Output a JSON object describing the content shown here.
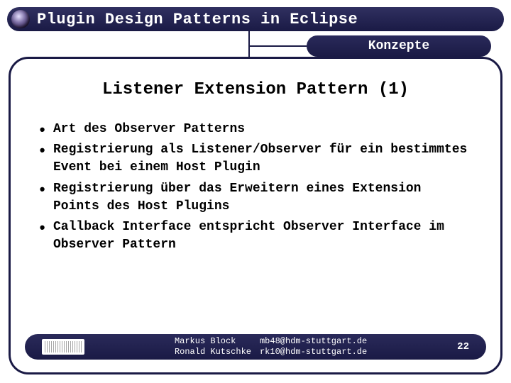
{
  "header": {
    "title": "Plugin Design Patterns in Eclipse",
    "badge": "Konzepte"
  },
  "slide": {
    "title": "Listener Extension Pattern (1)",
    "bullets": [
      "Art des Observer Patterns",
      "Registrierung als Listener/Observer für ein bestimmtes Event bei einem Host Plugin",
      "Registrierung über das Erweitern eines Extension Points des Host Plugins",
      "Callback Interface entspricht Observer Interface im Observer Pattern"
    ]
  },
  "footer": {
    "author1_name": "Markus Block",
    "author1_email": "mb48@hdm-stuttgart.de",
    "author2_name": "Ronald Kutschke",
    "author2_email": "rk10@hdm-stuttgart.de",
    "page": "22"
  }
}
